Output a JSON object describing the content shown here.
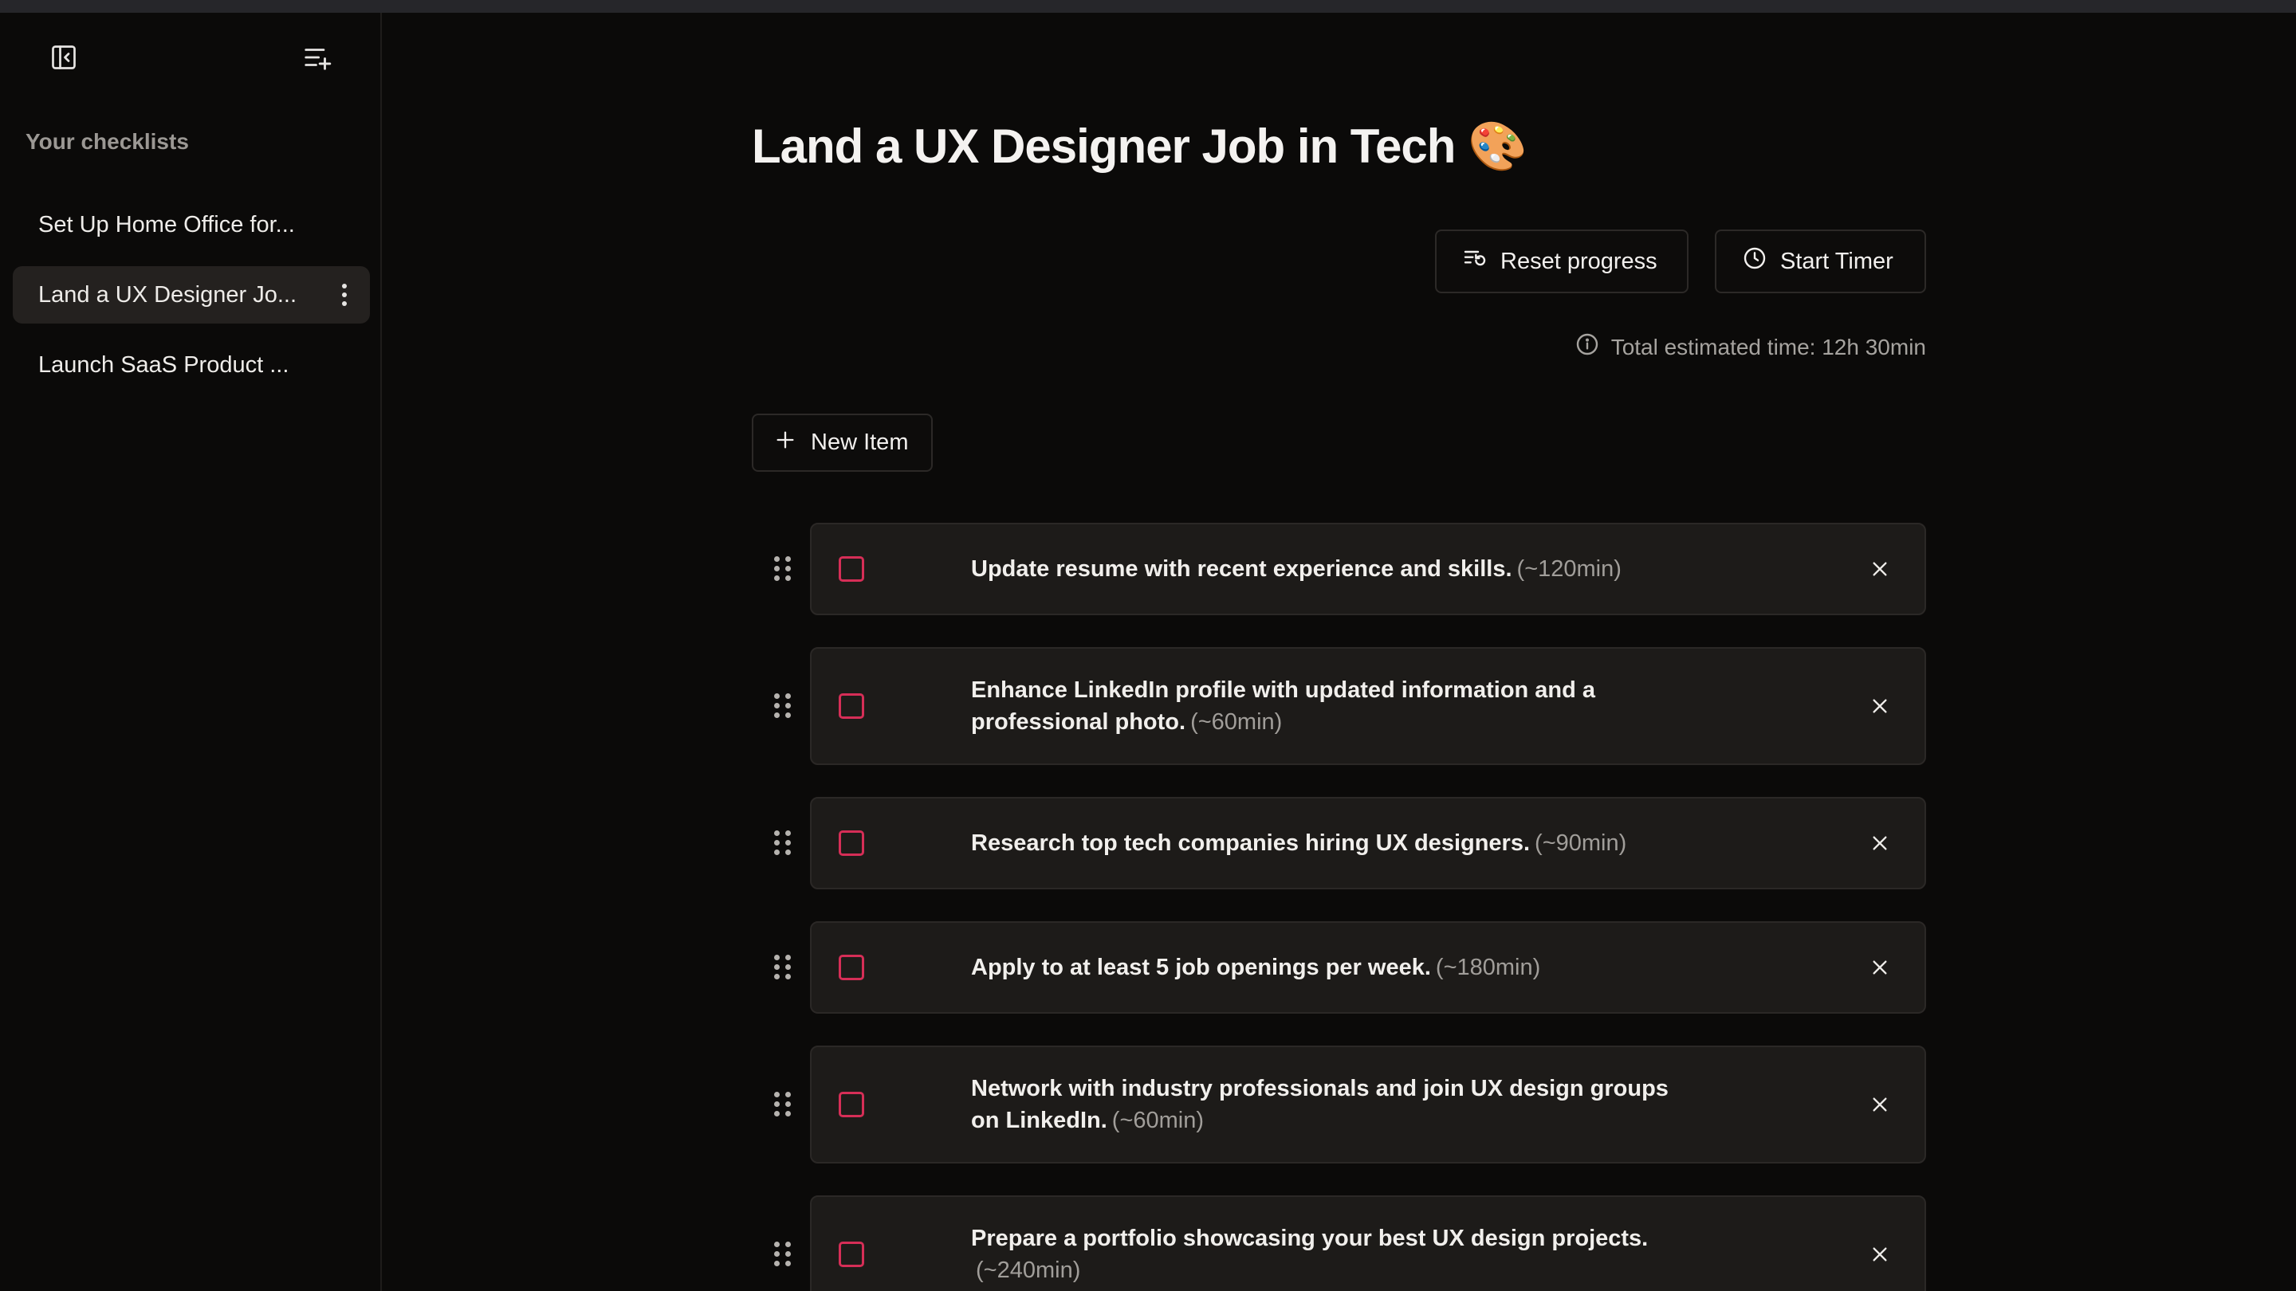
{
  "sidebar": {
    "heading": "Your checklists",
    "items": [
      {
        "label": "Set Up Home Office for..."
      },
      {
        "label": "Land a UX Designer Jo..."
      },
      {
        "label": "Launch SaaS Product ..."
      }
    ]
  },
  "main": {
    "title": "Land a UX Designer Job in Tech 🎨",
    "reset_label": "Reset progress",
    "timer_label": "Start Timer",
    "estimate": "Total estimated time: 12h 30min",
    "new_item_label": "New Item",
    "items": [
      {
        "text": "Update resume with recent experience and skills.",
        "time": "(~120min)",
        "checked": false
      },
      {
        "text": "Enhance LinkedIn profile with updated information and a professional photo.",
        "time": "(~60min)",
        "checked": false
      },
      {
        "text": "Research top tech companies hiring UX designers.",
        "time": "(~90min)",
        "checked": false
      },
      {
        "text": "Apply to at least 5 job openings per week.",
        "time": "(~180min)",
        "checked": false
      },
      {
        "text": "Network with industry professionals and join UX design groups on LinkedIn.",
        "time": "(~60min)",
        "checked": false
      },
      {
        "text": "Prepare a portfolio showcasing your best UX design projects.",
        "time": "(~240min)",
        "checked": false
      }
    ]
  },
  "colors": {
    "background": "#0b0a09",
    "card": "#1d1b19",
    "checkbox_accent": "#d62e57",
    "muted_text": "#a19e9a"
  },
  "icons": {
    "sidebar_collapse": "panel-left-close-icon",
    "new_checklist": "list-plus-icon",
    "more": "vertical-dots-icon",
    "reset": "list-restart-icon",
    "timer": "clock-icon",
    "info": "info-icon",
    "add": "plus-icon",
    "drag": "grip-vertical-icon",
    "remove": "close-icon"
  }
}
